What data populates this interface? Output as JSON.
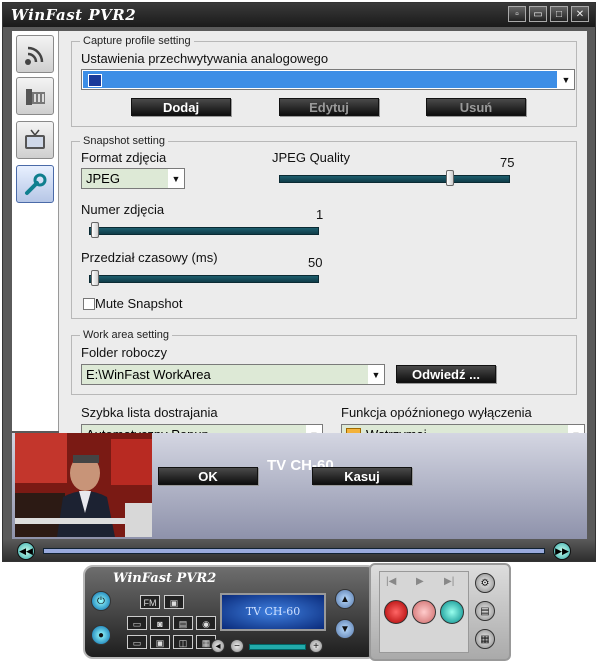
{
  "window": {
    "app_title": "WinFast PVR2",
    "controls": [
      "▫",
      "▭",
      "□",
      "✕"
    ]
  },
  "nav": [
    {
      "name": "signal",
      "icon": "antenna-icon"
    },
    {
      "name": "device",
      "icon": "tuner-card-icon"
    },
    {
      "name": "tv",
      "icon": "tv-icon"
    },
    {
      "name": "settings",
      "icon": "wrench-icon",
      "active": true
    }
  ],
  "capture": {
    "legend": "Capture profile setting",
    "label": "Ustawienia przechwytywania analogowego",
    "selected": "",
    "add": "Dodaj",
    "edit": "Edytuj",
    "delete": "Usuń"
  },
  "snapshot": {
    "legend": "Snapshot setting",
    "format_label": "Format zdjęcia",
    "format_value": "JPEG",
    "quality_label": "JPEG Quality",
    "quality_value": "75",
    "quality": 75,
    "number_label": "Numer zdjęcia",
    "number_value": "1",
    "number": 1,
    "interval_label": "Przedział czasowy (ms)",
    "interval_value": "50",
    "interval": 50,
    "mute_label": "Mute Snapshot",
    "mute_checked": false
  },
  "workarea": {
    "legend": "Work area setting",
    "folder_label": "Folder roboczy",
    "folder_value": "E:\\WinFast WorkArea",
    "visit": "Odwiedź ..."
  },
  "misc": {
    "tuning_label": "Szybka lista dostrajania",
    "tuning_value": "Automatyczny Popup",
    "sleep_label": "Funkcja opóźnionego wyłączenia",
    "sleep_value": "Wstrzymaj"
  },
  "footer": {
    "ok": "OK",
    "cancel": "Kasuj",
    "channel": "TV CH-60"
  },
  "remote": {
    "title": "WinFast PVR2",
    "display": "TV CH-60",
    "fm": "FM"
  },
  "colors": {
    "selection": "#3d8ee6",
    "combo_fill": "#dde9d6",
    "slider": "#1d5e6d"
  }
}
